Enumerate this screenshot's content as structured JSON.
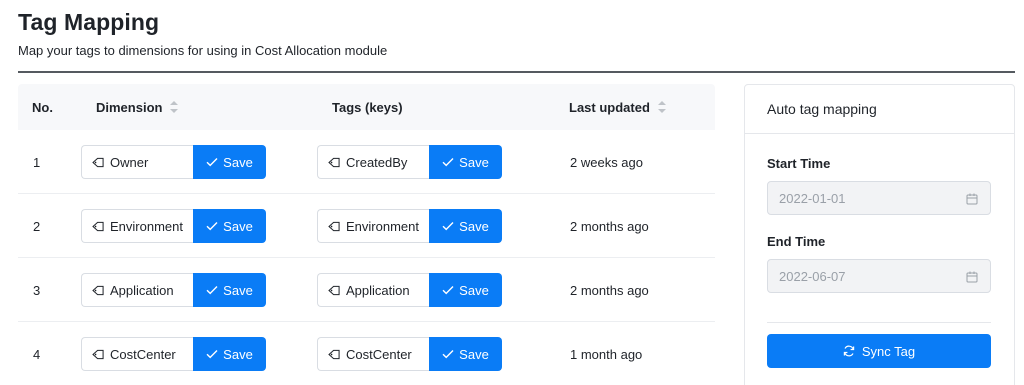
{
  "header": {
    "title": "Tag Mapping",
    "subtitle": "Map your tags to dimensions for using in Cost Allocation module"
  },
  "table": {
    "columns": {
      "no": "No.",
      "dimension": "Dimension",
      "tags": "Tags (keys)",
      "last_updated": "Last updated"
    },
    "save_label": "Save",
    "rows": [
      {
        "no": "1",
        "dimension": "Owner",
        "tag": "CreatedBy",
        "last_updated": "2 weeks ago"
      },
      {
        "no": "2",
        "dimension": "Environment",
        "tag": "Environment",
        "last_updated": "2 months ago"
      },
      {
        "no": "3",
        "dimension": "Application",
        "tag": "Application",
        "last_updated": "2 months ago"
      },
      {
        "no": "4",
        "dimension": "CostCenter",
        "tag": "CostCenter",
        "last_updated": "1 month ago"
      }
    ]
  },
  "auto_mapping": {
    "title": "Auto tag mapping",
    "start_label": "Start Time",
    "start_value": "2022-01-01",
    "end_label": "End Time",
    "end_value": "2022-06-07",
    "sync_label": "Sync Tag"
  },
  "colors": {
    "primary": "#0a7cf6",
    "header_bg": "#f7f8fa",
    "divider": "#555a60"
  }
}
